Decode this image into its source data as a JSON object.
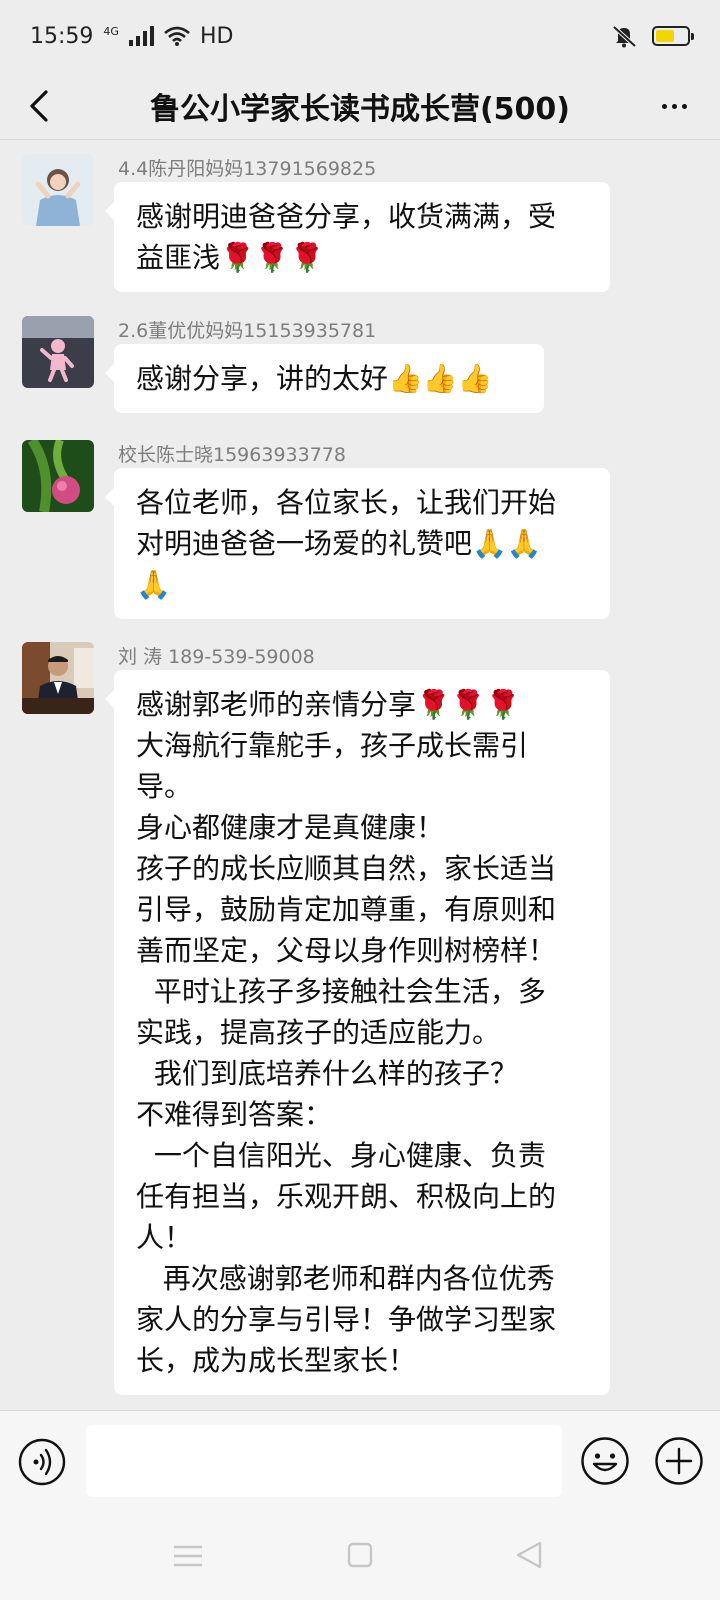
{
  "status_bar": {
    "time": "15:59",
    "network": "4G",
    "hd": "HD"
  },
  "header": {
    "title": "鲁公小学家长读书成长营(500)"
  },
  "messages": [
    {
      "sender": "4.4陈丹阳妈妈13791569825",
      "lines": [
        "感谢明迪爸爸分享，收货满满，受",
        "益匪浅🌹🌹🌹"
      ]
    },
    {
      "sender": "2.6董优优妈妈15153935781",
      "lines": [
        "感谢分享，讲的太好👍👍👍"
      ]
    },
    {
      "sender": "校长陈士晓15963933778",
      "lines": [
        "各位老师，各位家长，让我们开始",
        "对明迪爸爸一场爱的礼赞吧🙏🙏",
        "🙏"
      ]
    },
    {
      "sender": "刘 涛 189-539-59008",
      "lines": [
        "感谢郭老师的亲情分享🌹🌹🌹",
        "大海航行靠舵手，孩子成长需引",
        "导。",
        "身心都健康才是真健康！",
        "孩子的成长应顺其自然，家长适当",
        "引导，鼓励肯定加尊重，有原则和",
        "善而坚定，父母以身作则树榜样！",
        "  平时让孩子多接触社会生活，多",
        "实践，提高孩子的适应能力。",
        "  我们到底培养什么样的孩子？",
        "不难得到答案：",
        "  一个自信阳光、身心健康、负责",
        "任有担当，乐观开朗、积极向上的",
        "人！",
        "   再次感谢郭老师和群内各位优秀",
        "家人的分享与引导！争做学习型家",
        "长，成为成长型家长！"
      ]
    }
  ],
  "input": {
    "value": "",
    "placeholder": ""
  },
  "colors": {
    "chat_background": "#ededed",
    "bubble": "#ffffff",
    "sender_text": "#7d7d7d"
  }
}
